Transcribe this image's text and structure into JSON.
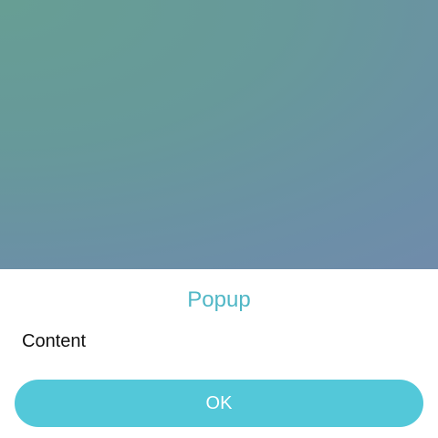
{
  "popup": {
    "title": "Popup",
    "content": "Content",
    "ok_label": "OK"
  },
  "colors": {
    "accent": "#53c8d9",
    "title": "#50b7c6",
    "backdrop_start": "#679e94",
    "backdrop_end": "#7885b2"
  }
}
